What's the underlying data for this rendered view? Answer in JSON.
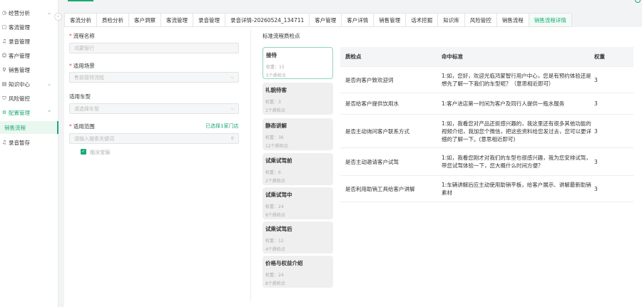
{
  "sidebar": {
    "items": [
      {
        "icon": "pie-chart-icon",
        "glyph": "◷",
        "label": "经营分析",
        "chevron": "⌄"
      },
      {
        "icon": "flow-icon",
        "glyph": "▢",
        "label": "客流管理"
      },
      {
        "icon": "mic-icon",
        "glyph": "♫",
        "label": "录音管理"
      },
      {
        "icon": "user-icon",
        "glyph": "☺",
        "label": "客户管理"
      },
      {
        "icon": "cart-icon",
        "glyph": "⚲",
        "label": "销售管理"
      },
      {
        "icon": "book-icon",
        "glyph": "▤",
        "label": "知识中心",
        "chevron": "⌄"
      },
      {
        "icon": "shield-icon",
        "glyph": "⛉",
        "label": "风险管控"
      },
      {
        "icon": "settings-icon",
        "glyph": "⚙",
        "label": "配置管理",
        "chevron": "⌃"
      },
      {
        "label": "销售流程"
      },
      {
        "icon": "mic-icon",
        "glyph": "♫",
        "label": "录音暂存"
      }
    ]
  },
  "tabs": [
    "客流分析",
    "质检分析",
    "客户洞察",
    "客流管理",
    "录音管理",
    "录音详情-20260524_134711",
    "客户管理",
    "客户详情",
    "销售管理",
    "话术挖掘",
    "知识库",
    "风险管控",
    "销售流程",
    "销售流程详情"
  ],
  "form": {
    "name_label": "流程名称",
    "name_value": "鸿蒙智行",
    "scene_label": "适用场景",
    "scene_value": "售前接待流程",
    "car_label": "适用车型",
    "car_placeholder": "请选择车型",
    "range_label": "适用范围",
    "range_link": "已选择1家门店",
    "search_placeholder": "请输入搜索关键词",
    "store_label": "临汾宝骊"
  },
  "flow": {
    "title": "标准流程质检点",
    "cards": [
      {
        "title": "接待",
        "weight": "权重：15",
        "count": "5个质检点"
      },
      {
        "title": "礼貌待客",
        "weight": "权重：3",
        "count": "1个质检点"
      },
      {
        "title": "静态讲解",
        "weight": "权重：36",
        "count": "12个质检点"
      },
      {
        "title": "试乘试驾前",
        "weight": "权重：6",
        "count": "2个质检点"
      },
      {
        "title": "试乘试驾中",
        "weight": "权重：24",
        "count": "8个质检点"
      },
      {
        "title": "试乘试驾后",
        "weight": "权重：12",
        "count": "4个质检点"
      },
      {
        "title": "价格与权益介绍",
        "weight": "权重：24",
        "count": "8个质检点"
      }
    ]
  },
  "table": {
    "headers": [
      "质检点",
      "命中标准",
      "权重"
    ],
    "rows": [
      [
        "是否向客户致欢迎词",
        "1:如，您好，欢迎光临鸿蒙智行用户中心，您是有预约体验还是想先了解一下我们的车型呢？（意思相近即可）",
        "3"
      ],
      [
        "是否给客户提供饮用水",
        "1:客户进店第一时间为客户及同行人提供一瓶水服务",
        "3"
      ],
      [
        "是否主动询问客户联系方式",
        "1:如，我看您对产品还挺感兴趣的，我这里还有很多其他功能的视频介绍，我加您个微信，把这些资料给您发过去，您可以更详细的了解一下。(意思相近即可)",
        "3"
      ],
      [
        "是否主动邀请客户试驾",
        "1:如，我看您刚才对我们的车型也很感兴趣，我为您安排试驾，带您试驾体验一下，您大概什么时间方便？",
        "3"
      ],
      [
        "是否利用助销工具给客户讲解",
        "1:车辆讲解后应主动使用助销平板，给客户展示、讲解最新助销素材",
        "3"
      ]
    ]
  },
  "colors": {
    "accent": "#1aaa74",
    "required": "#e54d42"
  }
}
